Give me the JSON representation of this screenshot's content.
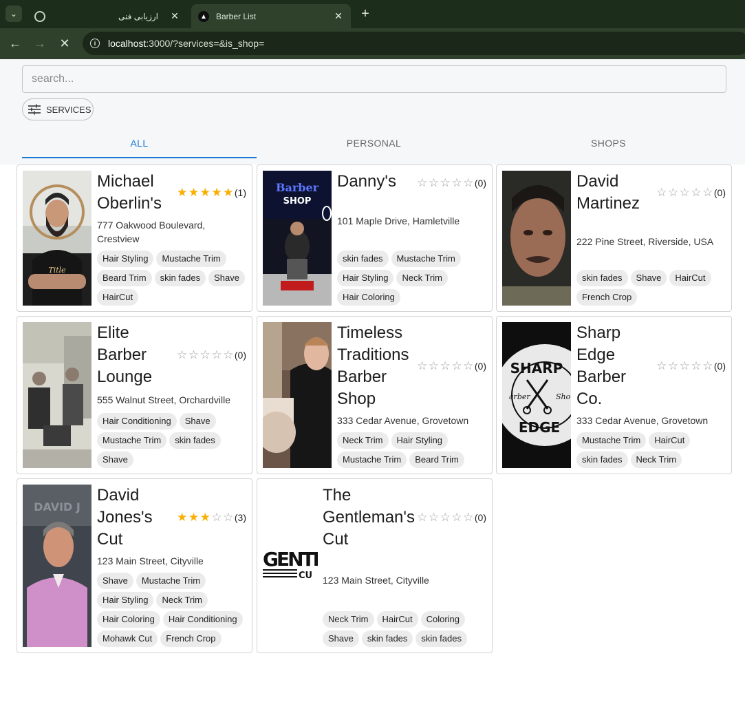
{
  "browser": {
    "tabs": [
      {
        "title": "ارزیابی فنی"
      },
      {
        "title": "Barber List"
      }
    ],
    "url_host": "localhost",
    "url_rest": ":3000/?services=&is_shop="
  },
  "search": {
    "placeholder": "search..."
  },
  "filter": {
    "label": "SERVICES"
  },
  "nav_tabs": {
    "all": "ALL",
    "personal": "PERSONAL",
    "shops": "SHOPS"
  },
  "colors": {
    "accent": "#1976d2",
    "star": "#faaf00",
    "chip_bg": "#ebebeb"
  },
  "barbers": [
    {
      "name": "Michael Oberlin's",
      "rating": 5,
      "reviews": "(1)",
      "address": "777 Oakwood Boulevard, Crestview",
      "services": [
        "Hair Styling",
        "Mustache Trim",
        "Beard Trim",
        "skin fades",
        "Shave",
        "HairCut"
      ]
    },
    {
      "name": "Danny's",
      "rating": 0,
      "reviews": "(0)",
      "address": "101 Maple Drive, Hamletville",
      "services": [
        "skin fades",
        "Mustache Trim",
        "Hair Styling",
        "Neck Trim",
        "Hair Coloring"
      ]
    },
    {
      "name": "David Martinez",
      "rating": 0,
      "reviews": "(0)",
      "address": "222 Pine Street, Riverside, USA",
      "services": [
        "skin fades",
        "Shave",
        "HairCut",
        "French Crop"
      ]
    },
    {
      "name": "Elite Barber Lounge",
      "rating": 0,
      "reviews": "(0)",
      "address": "555 Walnut Street, Orchardville",
      "services": [
        "Hair Conditioning",
        "Shave",
        "Mustache Trim",
        "skin fades",
        "Shave"
      ]
    },
    {
      "name": "Timeless Traditions Barber Shop",
      "rating": 0,
      "reviews": "(0)",
      "address": "333 Cedar Avenue, Grovetown",
      "services": [
        "Neck Trim",
        "Hair Styling",
        "Mustache Trim",
        "Beard Trim"
      ]
    },
    {
      "name": "Sharp Edge Barber Co.",
      "rating": 0,
      "reviews": "(0)",
      "address": "333 Cedar Avenue, Grovetown",
      "services": [
        "Mustache Trim",
        "HairCut",
        "skin fades",
        "Neck Trim"
      ]
    },
    {
      "name": "David Jones's Cut",
      "rating": 3,
      "reviews": "(3)",
      "address": "123 Main Street, Cityville",
      "services": [
        "Shave",
        "Mustache Trim",
        "Hair Styling",
        "Neck Trim",
        "Hair Coloring",
        "Hair Conditioning",
        "Mohawk Cut",
        "French Crop"
      ]
    },
    {
      "name": "The Gentleman's Cut",
      "rating": 0,
      "reviews": "(0)",
      "address": "123 Main Street, Cityville",
      "services": [
        "Neck Trim",
        "HairCut",
        "Coloring",
        "Shave",
        "skin fades",
        "skin fades"
      ]
    }
  ],
  "logos": {
    "sharp_edge": "SHARP Barber Shop EDGE",
    "gentleman": "GENTLEM CU"
  }
}
